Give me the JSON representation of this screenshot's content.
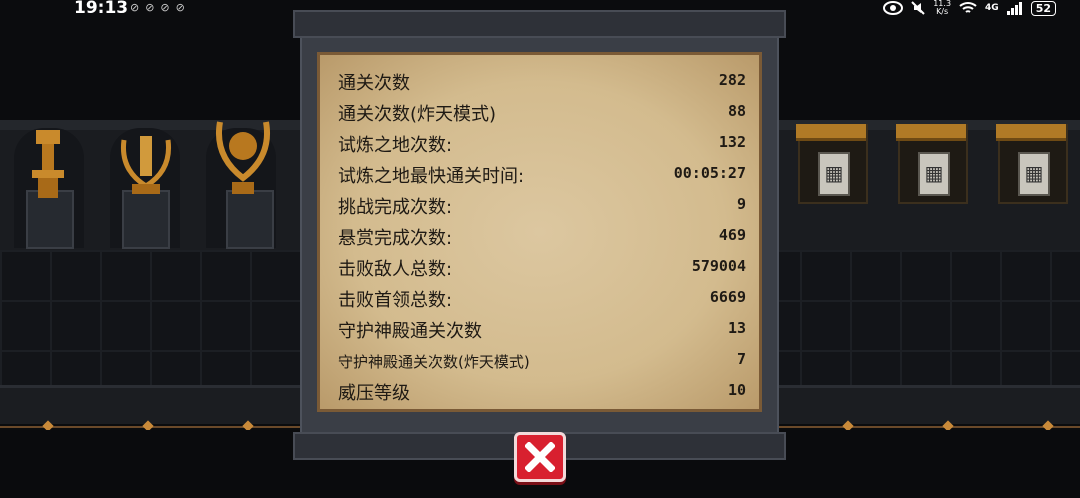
{
  "status_bar": {
    "time": "19:13",
    "notif_icons": [
      "notification-dot-icon",
      "notification-dot-icon",
      "notification-dot-icon",
      "notification-dot-icon"
    ],
    "speed_value": "11.3",
    "speed_unit": "K/s",
    "network": "4G",
    "battery": "52"
  },
  "stats_panel": {
    "rows": [
      {
        "label": "通关次数",
        "value": "282"
      },
      {
        "label": "通关次数(炸天模式)",
        "value": "88"
      },
      {
        "label": "试炼之地次数:",
        "value": "132"
      },
      {
        "label": "试炼之地最快通关时间:",
        "value": "00:05:27"
      },
      {
        "label": "挑战完成次数:",
        "value": "9"
      },
      {
        "label": "悬赏完成次数:",
        "value": "469"
      },
      {
        "label": "击败敌人总数:",
        "value": "579004"
      },
      {
        "label": "击败首领总数:",
        "value": "6669"
      },
      {
        "label": "守护神殿通关次数",
        "value": "13"
      },
      {
        "label": "守护神殿通关次数(炸天模式)",
        "value": "7"
      },
      {
        "label": "威压等级",
        "value": "10"
      }
    ]
  },
  "close_button": {
    "icon": "close-x-icon",
    "color": "#d8202f"
  },
  "scene": {
    "trophies": [
      "trophy-cup-icon",
      "laurel-trophy-icon",
      "wreath-trophy-icon"
    ],
    "cabinets": [
      "locked-card-cabinet",
      "locked-card-cabinet",
      "locked-card-cabinet"
    ]
  }
}
